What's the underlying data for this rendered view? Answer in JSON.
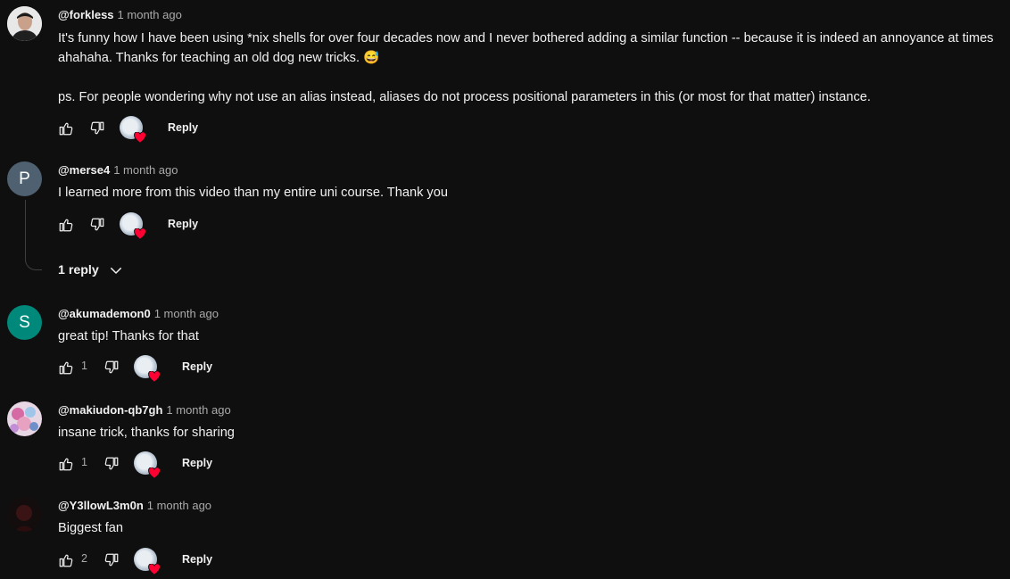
{
  "comments": [
    {
      "author": "@forkless",
      "time": "1 month ago",
      "text": "It's funny how I have been using *nix shells for over four decades now and I never bothered adding a similar function -- because it is indeed an annoyance at times ahahaha. Thanks for teaching an old dog new tricks. 😅\n\nps. For people wondering why not use an alias instead, aliases do not process positional parameters in this (or most for that matter) instance.",
      "likes": "",
      "reply_label": "Reply",
      "avatar": "photo"
    },
    {
      "author": "@merse4",
      "time": "1 month ago",
      "text": "I learned more from this video than my entire uni course. Thank you",
      "likes": "",
      "reply_label": "Reply",
      "avatar_letter": "P",
      "avatar_color": "#4f6170"
    },
    {
      "author": "@akumademon0",
      "time": "1 month ago",
      "text": "great tip! Thanks for that",
      "likes": "1",
      "reply_label": "Reply",
      "avatar_letter": "S",
      "avatar_color": "#00897b"
    },
    {
      "author": "@makiudon-qb7gh",
      "time": "1 month ago",
      "text": "insane trick, thanks for sharing",
      "likes": "1",
      "reply_label": "Reply",
      "avatar": "photo"
    },
    {
      "author": "@Y3llowL3m0n",
      "time": "1 month ago",
      "text": "Biggest fan",
      "likes": "2",
      "reply_label": "Reply",
      "avatar": "photo"
    }
  ],
  "replies_toggle": "1 reply",
  "colors": {
    "background": "#0f0f0f",
    "text": "#f1f1f1",
    "secondary": "#aaaaaa",
    "heart": "#ff0033"
  }
}
